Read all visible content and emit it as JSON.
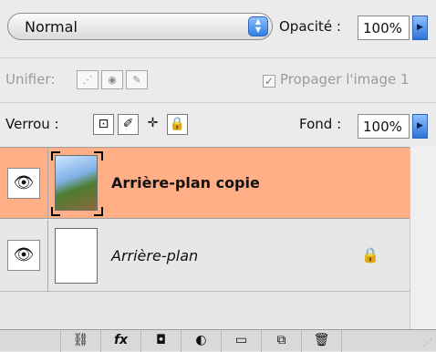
{
  "toolbar": {
    "blend_mode": "Normal",
    "opacity_label": "Opacité :",
    "opacity_value": "100%"
  },
  "unify": {
    "label": "Unifier:",
    "propagate_label": "Propager l'image 1",
    "icons": [
      "unify-position-icon",
      "unify-visibility-icon",
      "unify-style-icon"
    ]
  },
  "lock": {
    "label": "Verrou :",
    "fill_label": "Fond :",
    "fill_value": "100%",
    "icons": [
      "lock-transparent-pixels-icon",
      "lock-image-pixels-icon",
      "lock-position-icon",
      "lock-all-icon"
    ]
  },
  "layers": [
    {
      "name": "Arrière-plan copie",
      "selected": true,
      "visible": true,
      "locked": false
    },
    {
      "name": "Arrière-plan",
      "selected": false,
      "visible": true,
      "locked": true
    }
  ],
  "bottom_bar": {
    "buttons": [
      {
        "name": "link-layers-button",
        "glyph": "⛓"
      },
      {
        "name": "layer-style-button",
        "glyph": "fx"
      },
      {
        "name": "add-mask-button",
        "glyph": "◘"
      },
      {
        "name": "new-adjustment-layer-button",
        "glyph": "◐"
      },
      {
        "name": "new-group-button",
        "glyph": "▭"
      },
      {
        "name": "new-layer-button",
        "glyph": "⧉"
      },
      {
        "name": "delete-layer-button",
        "glyph": "🗑"
      }
    ]
  },
  "colors": {
    "selected_row": "#ffae85",
    "panel_bg": "#ebebeb",
    "accent": "#2f7fe3"
  }
}
